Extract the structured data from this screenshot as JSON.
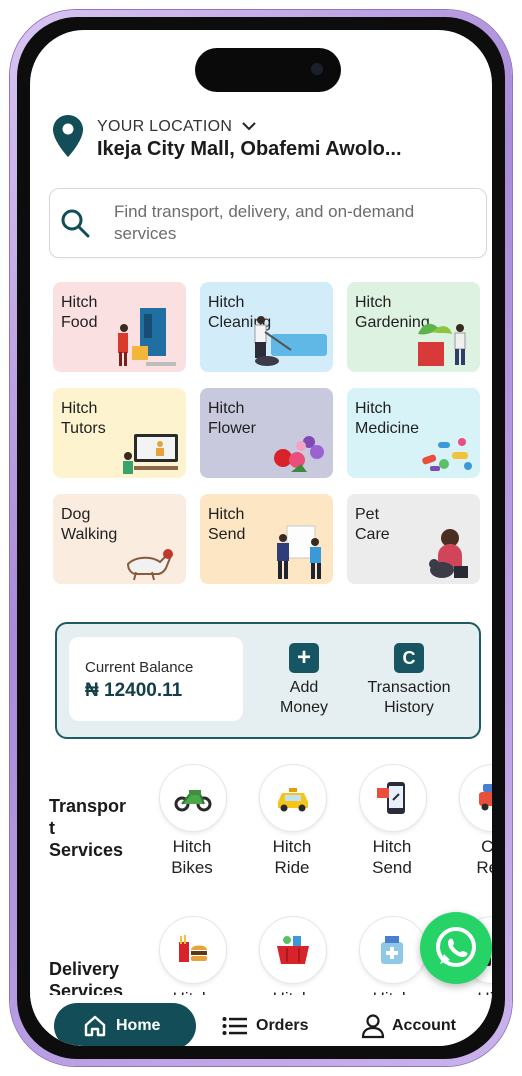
{
  "location": {
    "label": "YOUR LOCATION",
    "value": "Ikeja City Mall, Obafemi Awolo..."
  },
  "search": {
    "placeholder": "Find transport, delivery, and on-demand services"
  },
  "services": [
    {
      "label": "Hitch\nFood",
      "bg": "#fbe0e2"
    },
    {
      "label": "Hitch\nCleaning",
      "bg": "#d2ecfa"
    },
    {
      "label": "Hitch\nGardening",
      "bg": "#def2e1"
    },
    {
      "label": "Hitch\nTutors",
      "bg": "#fdf3cf"
    },
    {
      "label": "Hitch\nFlower",
      "bg": "#c9c9de"
    },
    {
      "label": "Hitch\nMedicine",
      "bg": "#d7f3f8"
    },
    {
      "label": "Dog\nWalking",
      "bg": "#fbece0"
    },
    {
      "label": "Hitch\nSend",
      "bg": "#fde6c4"
    },
    {
      "label": "Pet\nCare",
      "bg": "#ececec"
    }
  ],
  "wallet": {
    "balance_label": "Current Balance",
    "balance_value": "₦ 12400.11",
    "add_money": "Add\nMoney",
    "add_money_icon": "+",
    "history": "Transaction\nHistory",
    "history_icon": "C"
  },
  "transport": {
    "title": "Transpor\nt\nServices",
    "items": [
      {
        "label": "Hitch\nBikes",
        "icon": "motorbike-icon"
      },
      {
        "label": "Hitch\nRide",
        "icon": "taxi-icon"
      },
      {
        "label": "Hitch\nSend",
        "icon": "parcel-phone-icon"
      },
      {
        "label": "Ca\nRen",
        "icon": "car-rental-icon"
      }
    ]
  },
  "delivery": {
    "title": "Delivery\nServices",
    "items": [
      {
        "label": "Hitch",
        "icon": "fast-food-icon"
      },
      {
        "label": "Hitch",
        "icon": "basket-icon"
      },
      {
        "label": "Hitch",
        "icon": "medicine-icon"
      },
      {
        "label": "Hitc",
        "icon": "drinks-icon"
      }
    ]
  },
  "nav": {
    "home": "Home",
    "orders": "Orders",
    "account": "Account"
  },
  "colors": {
    "primary": "#134e58",
    "whatsapp": "#25d366"
  }
}
